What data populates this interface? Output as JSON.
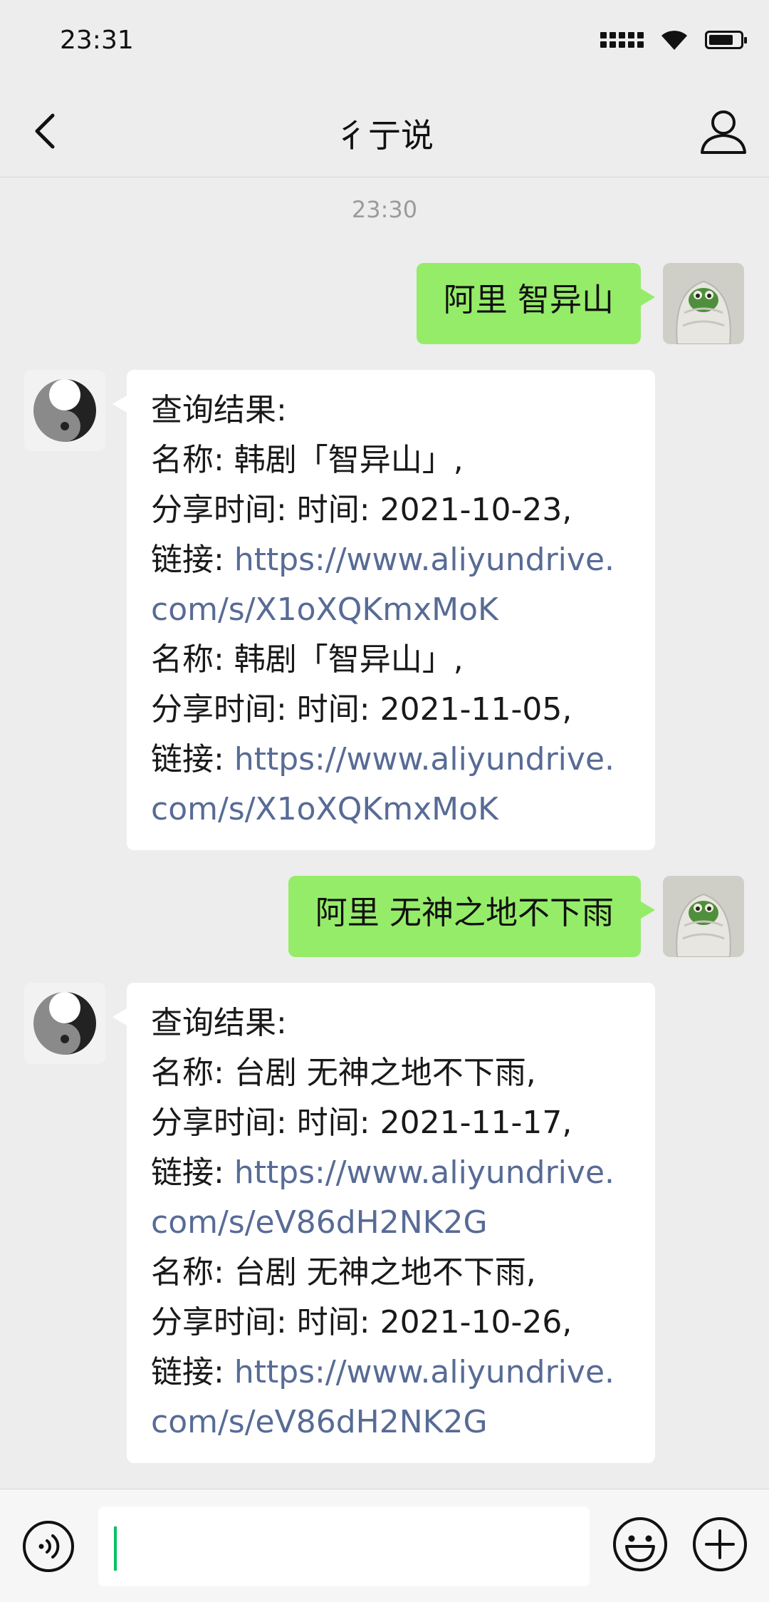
{
  "status_bar": {
    "time": "23:31",
    "battery_level": 0.78
  },
  "nav": {
    "title": "彳亍说",
    "back_icon": "chevron-left-icon",
    "profile_icon": "person-icon"
  },
  "chat": {
    "timestamp": "23:30",
    "messages": [
      {
        "from": "self",
        "text": "阿里 智异山"
      },
      {
        "from": "bot",
        "lines": [
          {
            "label": "查询结果:",
            "value": ""
          },
          {
            "label": "名称: 韩剧「智异山」,",
            "value": ""
          },
          {
            "label": "分享时间: 时间: 2021-10-23,",
            "value": ""
          },
          {
            "label": "链接: ",
            "value": "https://www.aliyundrive."
          },
          {
            "label": "",
            "value": "com/s/X1oXQKmxMoK"
          },
          {
            "label": "名称: 韩剧「智异山」,",
            "value": ""
          },
          {
            "label": "分享时间: 时间: 2021-11-05,",
            "value": ""
          },
          {
            "label": "链接: ",
            "value": "https://www.aliyundrive."
          },
          {
            "label": "",
            "value": "com/s/X1oXQKmxMoK"
          }
        ]
      },
      {
        "from": "self",
        "text": "阿里 无神之地不下雨"
      },
      {
        "from": "bot",
        "lines": [
          {
            "label": "查询结果:",
            "value": ""
          },
          {
            "label": "名称: 台剧 无神之地不下雨,",
            "value": ""
          },
          {
            "label": "分享时间: 时间: 2021-11-17,",
            "value": ""
          },
          {
            "label": "链接: ",
            "value": "https://www.aliyundrive."
          },
          {
            "label": "",
            "value": "com/s/eV86dH2NK2G"
          },
          {
            "label": "名称: 台剧 无神之地不下雨,",
            "value": ""
          },
          {
            "label": "分享时间: 时间: 2021-10-26,",
            "value": ""
          },
          {
            "label": "链接: ",
            "value": "https://www.aliyundrive."
          },
          {
            "label": "",
            "value": "com/s/eV86dH2NK2G"
          }
        ]
      }
    ]
  },
  "input_bar": {
    "voice_icon": "voice-icon",
    "emoji_icon": "emoji-icon",
    "plus_icon": "plus-icon",
    "input_value": ""
  },
  "colors": {
    "self_bubble": "#95ec69",
    "bot_bubble": "#ffffff",
    "link": "#576b95",
    "background": "#ededed"
  }
}
